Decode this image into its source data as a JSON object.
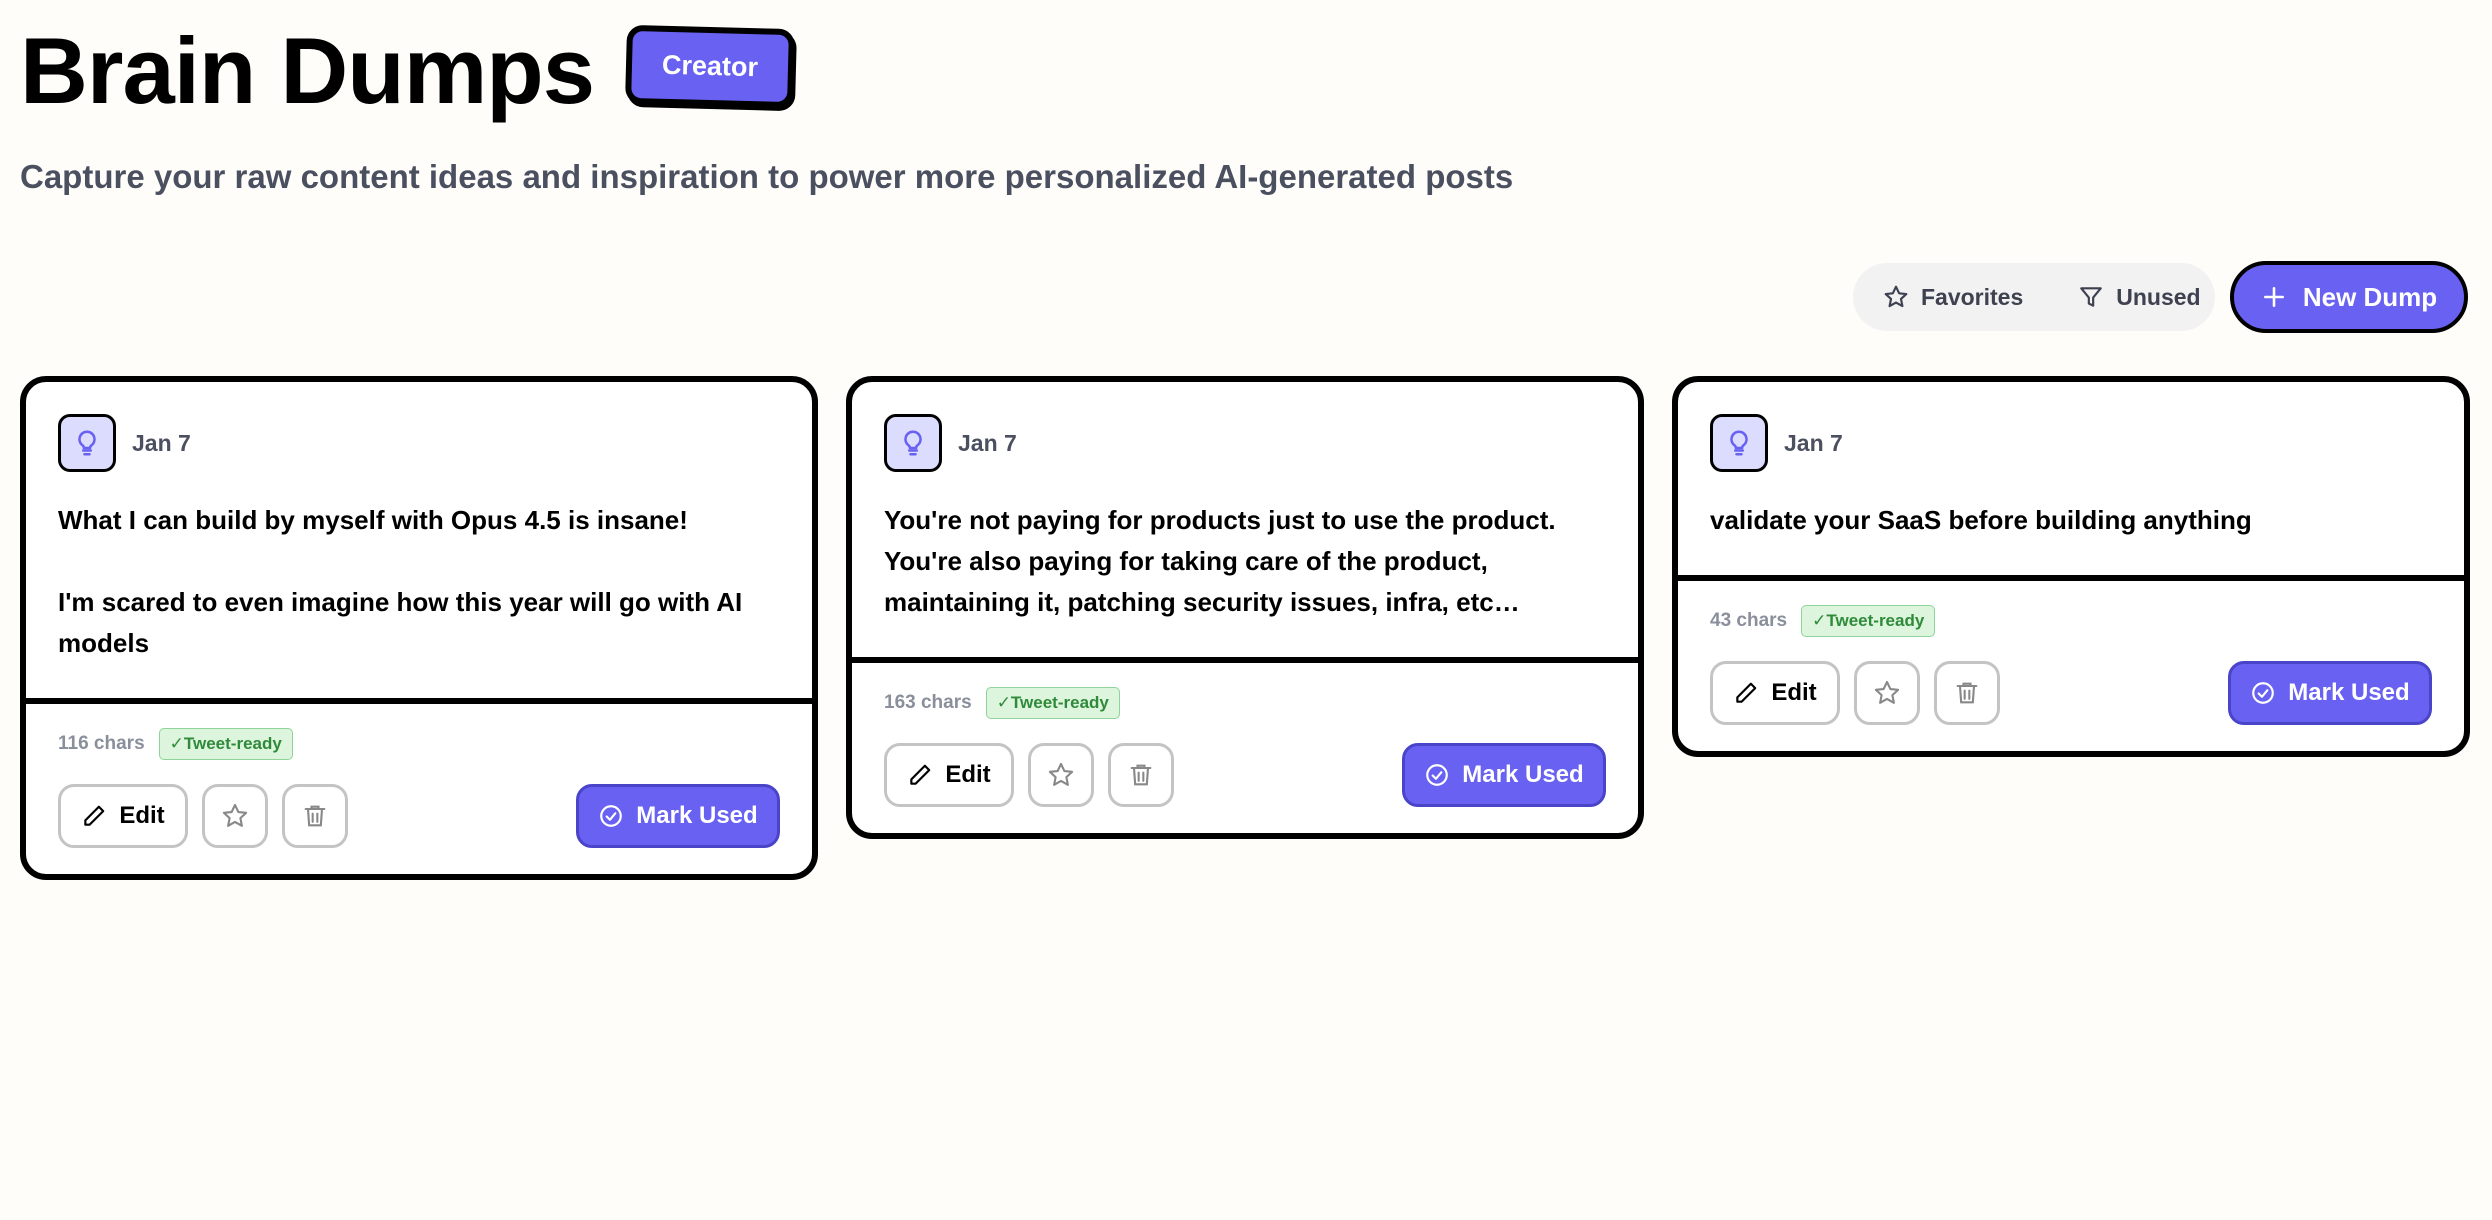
{
  "header": {
    "title": "Brain Dumps",
    "badge": "Creator",
    "subtitle": "Capture your raw content ideas and inspiration to power more personalized AI-generated posts"
  },
  "toolbar": {
    "favorites_label": "Favorites",
    "unused_label": "Unused",
    "new_dump_label": "New Dump"
  },
  "colors": {
    "accent": "#6861f2",
    "background": "#fefdf9",
    "tweet_ready_bg": "#dcf5dc",
    "tweet_ready_text": "#2f8a3a"
  },
  "cards": [
    {
      "date": "Jan 7",
      "text": "What I can build by myself with Opus 4.5 is insane!\n\nI'm scared to even imagine how this year will go with AI models",
      "chars": "116 chars",
      "badge": "✓Tweet-ready",
      "edit_label": "Edit",
      "mark_used_label": "Mark Used"
    },
    {
      "date": "Jan 7",
      "text": "You're not paying for products just to use the product. You're also paying for taking care of the product, maintaining it, patching security issues, infra, etc…",
      "chars": "163 chars",
      "badge": "✓Tweet-ready",
      "edit_label": "Edit",
      "mark_used_label": "Mark Used"
    },
    {
      "date": "Jan 7",
      "text": "validate your SaaS before building anything",
      "chars": "43 chars",
      "badge": "✓Tweet-ready",
      "edit_label": "Edit",
      "mark_used_label": "Mark Used"
    }
  ],
  "icons": {
    "card": "lightbulb-icon",
    "edit": "pencil-icon",
    "favorite": "star-icon",
    "delete": "trash-icon",
    "mark_used": "check-circle-icon",
    "favorites_filter": "star-icon",
    "unused_filter": "filter-icon",
    "new_dump": "plus-icon"
  }
}
